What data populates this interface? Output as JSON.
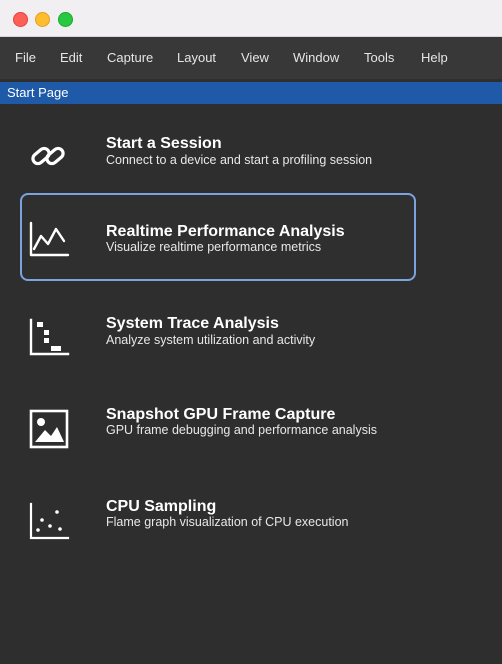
{
  "menubar": {
    "items": [
      "File",
      "Edit",
      "Capture",
      "Layout",
      "View",
      "Window",
      "Tools",
      "Help"
    ]
  },
  "tab": {
    "label": "Start Page"
  },
  "entries": [
    {
      "title": "Start a Session",
      "description": "Connect to a device and start a profiling session",
      "icon": "link-icon"
    },
    {
      "title": "Realtime Performance Analysis",
      "description": "Visualize realtime performance metrics",
      "icon": "line-chart-icon"
    },
    {
      "title": "System Trace Analysis",
      "description": "Analyze system utilization and activity",
      "icon": "trace-icon"
    },
    {
      "title": "Snapshot GPU Frame Capture",
      "description": "GPU frame debugging and performance analysis",
      "icon": "image-icon"
    },
    {
      "title": "CPU Sampling",
      "description": "Flame graph visualization of CPU execution",
      "icon": "scatter-icon"
    }
  ],
  "colors": {
    "accent": "#1f5aa8",
    "selection_border": "#7ba3e0"
  }
}
